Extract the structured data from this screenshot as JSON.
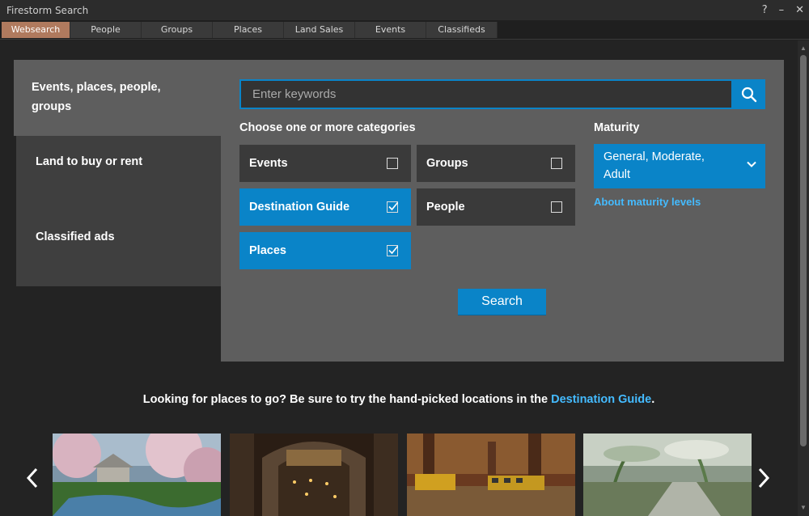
{
  "window": {
    "title": "Firestorm Search",
    "help": "?",
    "minimize": "–",
    "close": "✕"
  },
  "tabs": [
    {
      "label": "Websearch",
      "active": true
    },
    {
      "label": "People"
    },
    {
      "label": "Groups"
    },
    {
      "label": "Places"
    },
    {
      "label": "Land Sales"
    },
    {
      "label": "Events"
    },
    {
      "label": "Classifieds"
    }
  ],
  "sidebar": {
    "active": "Events, places, people, groups",
    "items": [
      "Land to buy or rent",
      "Classified ads"
    ]
  },
  "search": {
    "placeholder": "Enter keywords",
    "value": ""
  },
  "categories": {
    "heading": "Choose one or more categories",
    "items": [
      {
        "label": "Events",
        "checked": false
      },
      {
        "label": "Groups",
        "checked": false
      },
      {
        "label": "Destination Guide",
        "checked": true
      },
      {
        "label": "People",
        "checked": false
      },
      {
        "label": "Places",
        "checked": true
      }
    ]
  },
  "maturity": {
    "heading": "Maturity",
    "selected": "General, Moderate, Adult",
    "link": "About maturity levels"
  },
  "search_button": "Search",
  "promo": {
    "text": "Looking for places to go? Be sure to try the hand-picked locations in the ",
    "link": "Destination Guide",
    "suffix": "."
  },
  "colors": {
    "accent": "#0a84c8",
    "active_tab": "#b07a5e",
    "link": "#44bbff"
  }
}
